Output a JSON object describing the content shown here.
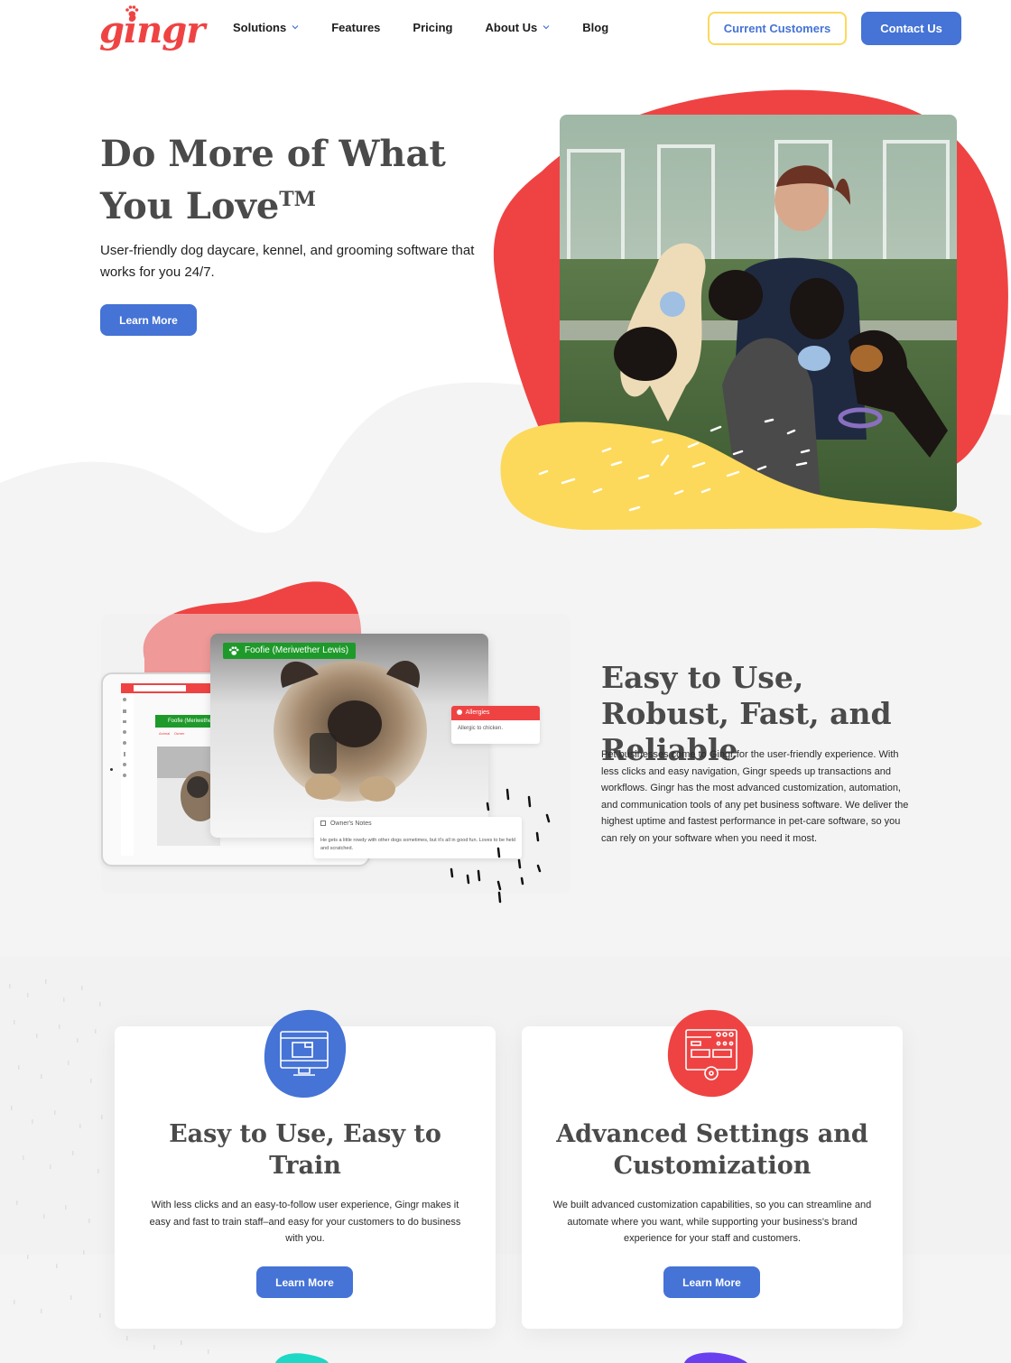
{
  "brand": {
    "name": "gingr",
    "colors": {
      "red": "#ef4343",
      "blue": "#4573d6",
      "yellow": "#fcd95a",
      "green": "#1e9a2a",
      "teal": "#1dd8c4",
      "purple": "#6a3ff0",
      "gray_bg": "#f4f4f4"
    }
  },
  "header": {
    "nav": [
      {
        "label": "Solutions",
        "has_dropdown": true
      },
      {
        "label": "Features",
        "has_dropdown": false
      },
      {
        "label": "Pricing",
        "has_dropdown": false
      },
      {
        "label": "About Us",
        "has_dropdown": true
      },
      {
        "label": "Blog",
        "has_dropdown": false
      }
    ],
    "current_customers_label": "Current Customers",
    "contact_label": "Contact Us"
  },
  "hero": {
    "title_line1": "Do More of What",
    "title_line2": "You Love",
    "title_tm": "TM",
    "subtitle": "User-friendly dog daycare, kennel, and grooming software that works for you 24/7.",
    "cta_label": "Learn More",
    "image_alt": "Woman in a kennel yard surrounded by puppies"
  },
  "showcase": {
    "pet_tag": "Foofie (Meriwether Lewis)",
    "tablet_tabs": [
      "Animal",
      "Owner"
    ],
    "allergies_title": "Allergies",
    "allergies_text": "Allergic to chicken.",
    "notes_title": "Owner's Notes",
    "notes_text": "He gets a little rowdy with other dogs sometimes, but it's all in good fun. Loves to be held and scratched.",
    "title": "Easy to Use, Robust, Fast, and Reliable",
    "body": "Pet businesses come to Gingr for the user-friendly experience. With less clicks and easy navigation, Gingr speeds up transactions and workflows. Gingr has the most advanced customization, automation, and communication tools of any pet business software. We deliver the highest uptime and fastest performance in pet-care software, so you can rely on your software when you need it most."
  },
  "features": [
    {
      "icon": "monitor-icon",
      "title": "Easy to Use, Easy to Train",
      "body": "With less clicks and an easy-to-follow user experience, Gingr makes it easy and fast to train staff–and easy for your customers to do business with you.",
      "cta_label": "Learn More"
    },
    {
      "icon": "settings-window-icon",
      "title": "Advanced Settings and Customization",
      "body": "We built advanced customization capabilities, so you can streamline and automate where you want, while supporting your business's brand experience for your staff and customers.",
      "cta_label": "Learn More"
    }
  ]
}
